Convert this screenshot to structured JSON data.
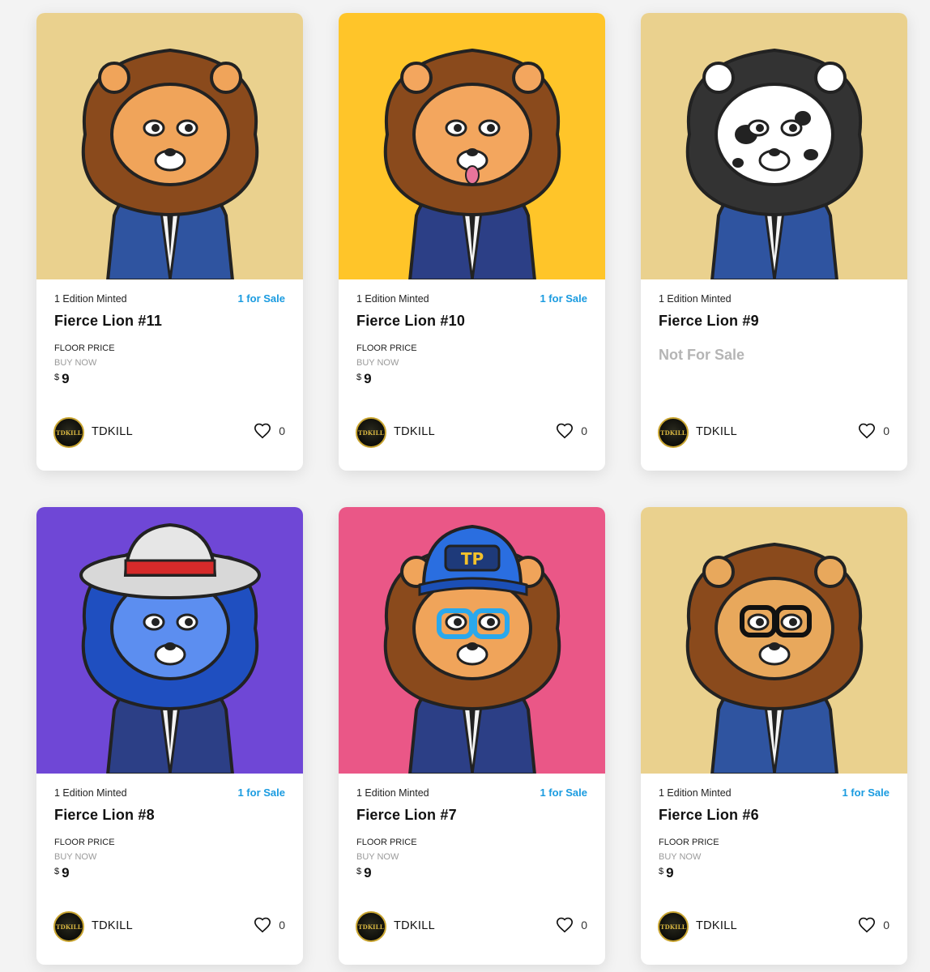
{
  "cards": [
    {
      "edition_text": "1 Edition Minted",
      "sale_text": "1 for Sale",
      "title": "Fierce Lion #11",
      "floor_label": "FLOOR PRICE",
      "buy_label": "BUY NOW",
      "currency": "$",
      "price": "9",
      "status": "for_sale",
      "creator": "TDKILL",
      "avatar_text": "TDKILL",
      "likes": "0",
      "bg_color": "#ead18e",
      "mane_color": "#8a4a1c",
      "face_color": "#f0a45a",
      "suit_color": "#2f54a0",
      "accessory": "none"
    },
    {
      "edition_text": "1 Edition Minted",
      "sale_text": "1 for Sale",
      "title": "Fierce Lion #10",
      "floor_label": "FLOOR PRICE",
      "buy_label": "BUY NOW",
      "currency": "$",
      "price": "9",
      "status": "for_sale",
      "creator": "TDKILL",
      "avatar_text": "TDKILL",
      "likes": "0",
      "bg_color": "#ffc529",
      "mane_color": "#8a4a1c",
      "face_color": "#f3a65e",
      "suit_color": "#2c3f86",
      "accessory": "tongue"
    },
    {
      "edition_text": "1 Edition Minted",
      "sale_text": "",
      "title": "Fierce Lion #9",
      "not_for_sale_text": "Not For Sale",
      "status": "not_for_sale",
      "creator": "TDKILL",
      "avatar_text": "TDKILL",
      "likes": "0",
      "bg_color": "#ead18e",
      "mane_color": "#333333",
      "face_color": "#ffffff",
      "suit_color": "#2f54a0",
      "accessory": "spots"
    },
    {
      "edition_text": "1 Edition Minted",
      "sale_text": "1 for Sale",
      "title": "Fierce Lion #8",
      "floor_label": "FLOOR PRICE",
      "buy_label": "BUY NOW",
      "currency": "$",
      "price": "9",
      "status": "for_sale",
      "creator": "TDKILL",
      "avatar_text": "TDKILL",
      "likes": "0",
      "bg_color": "#6f47d6",
      "mane_color": "#1f4fc0",
      "face_color": "#5c8ef0",
      "suit_color": "#2c3f86",
      "accessory": "hat"
    },
    {
      "edition_text": "1 Edition Minted",
      "sale_text": "1 for Sale",
      "title": "Fierce Lion #7",
      "floor_label": "FLOOR PRICE",
      "buy_label": "BUY NOW",
      "currency": "$",
      "price": "9",
      "status": "for_sale",
      "creator": "TDKILL",
      "avatar_text": "TDKILL",
      "likes": "0",
      "bg_color": "#ea5787",
      "mane_color": "#8a4a1c",
      "face_color": "#f0a45a",
      "suit_color": "#2c3f86",
      "accessory": "cap",
      "cap_text": "TP"
    },
    {
      "edition_text": "1 Edition Minted",
      "sale_text": "1 for Sale",
      "title": "Fierce Lion #6",
      "floor_label": "FLOOR PRICE",
      "buy_label": "BUY NOW",
      "currency": "$",
      "price": "9",
      "status": "for_sale",
      "creator": "TDKILL",
      "avatar_text": "TDKILL",
      "likes": "0",
      "bg_color": "#ead18e",
      "mane_color": "#8a4a1c",
      "face_color": "#e8a85c",
      "suit_color": "#2f54a0",
      "accessory": "glasses"
    }
  ]
}
